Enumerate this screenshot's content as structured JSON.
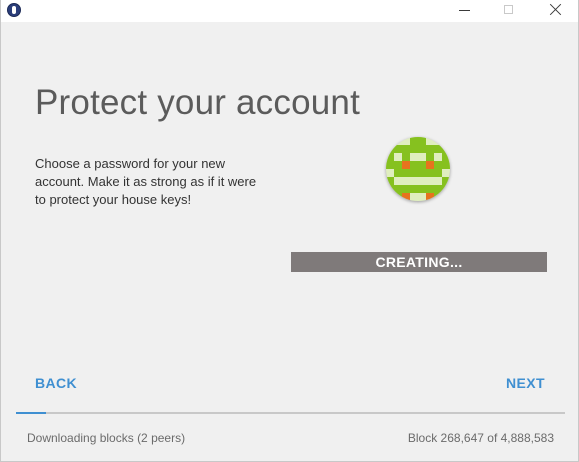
{
  "window": {
    "app_icon": "ethereum-icon",
    "controls": [
      "minimize-icon",
      "maximize-icon",
      "close-icon"
    ]
  },
  "main": {
    "title": "Protect your account",
    "description": "Choose a password for your new account. Make it as strong as if it were to protect your house keys!",
    "avatar_icon": "identicon",
    "status_label": "CREATING..."
  },
  "nav": {
    "back_label": "BACK",
    "next_label": "NEXT"
  },
  "footer": {
    "download_status": "Downloading blocks (2 peers)",
    "block_status": "Block 268,647 of 4,888,583",
    "sync_progress": 0.055
  },
  "colors": {
    "accent": "#3f8fd1",
    "status_bar_bg": "#7f7a7a",
    "avatar_green": "#86c11f",
    "avatar_orange": "#e6731e"
  }
}
